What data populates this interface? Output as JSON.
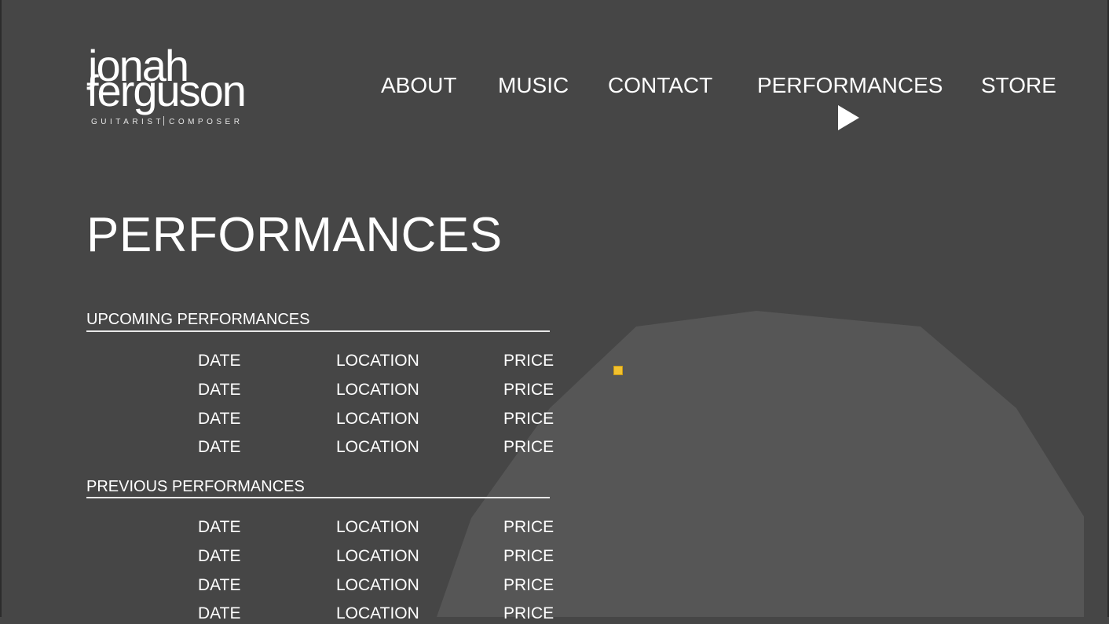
{
  "logo": {
    "first_name": "jonah",
    "last_name": "ferguson",
    "tagline_left": "GUITARIST",
    "tagline_right": "COMPOSER"
  },
  "nav": {
    "items": [
      {
        "label": "ABOUT"
      },
      {
        "label": "MUSIC"
      },
      {
        "label": "CONTACT"
      },
      {
        "label": "PERFORMANCES",
        "active": true
      },
      {
        "label": "STORE"
      }
    ]
  },
  "page": {
    "title": "PERFORMANCES"
  },
  "upcoming": {
    "heading": "UPCOMING PERFORMANCES",
    "rows": [
      {
        "date": "DATE",
        "location": "LOCATION",
        "price": "PRICE"
      },
      {
        "date": "DATE",
        "location": "LOCATION",
        "price": "PRICE"
      },
      {
        "date": "DATE",
        "location": "LOCATION",
        "price": "PRICE"
      },
      {
        "date": "DATE",
        "location": "LOCATION",
        "price": "PRICE"
      }
    ]
  },
  "previous": {
    "heading": "PREVIOUS PERFORMANCES",
    "rows": [
      {
        "date": "DATE",
        "location": "LOCATION",
        "price": "PRICE"
      },
      {
        "date": "DATE",
        "location": "LOCATION",
        "price": "PRICE"
      },
      {
        "date": "DATE",
        "location": "LOCATION",
        "price": "PRICE"
      },
      {
        "date": "DATE",
        "location": "LOCATION",
        "price": "PRICE"
      }
    ]
  },
  "colors": {
    "background": "#464646",
    "shape": "#565656",
    "text": "#ffffff",
    "marker": "#f2c12e"
  }
}
